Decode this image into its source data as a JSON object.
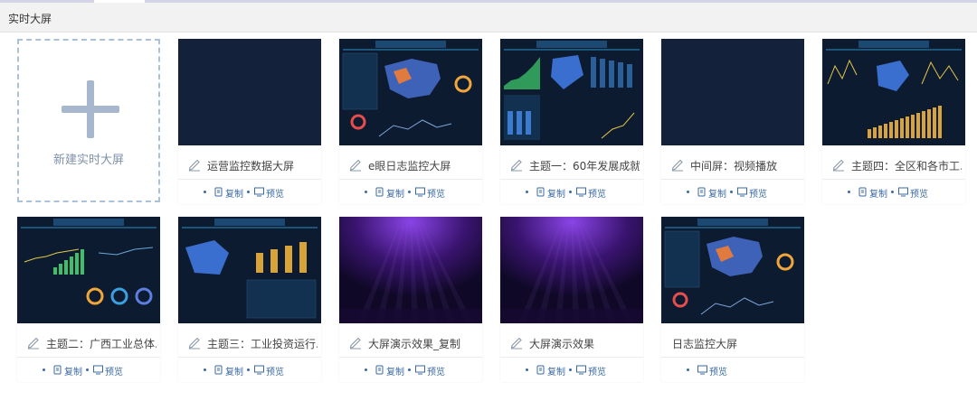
{
  "header": {
    "title": "实时大屏"
  },
  "new_card": {
    "label": "新建实时大屏"
  },
  "actions": {
    "copy": "复制",
    "preview": "预览"
  },
  "colors": {
    "accent": "#3b6aa3",
    "thumb_dark": "#14213a",
    "dashed": "#a9c1da"
  },
  "cards": [
    {
      "name": "运营监控数据大屏",
      "thumb": "blank",
      "editable": true,
      "copyable": true
    },
    {
      "name": "e眼日志监控大屏",
      "thumb": "map",
      "editable": true,
      "copyable": true
    },
    {
      "name": "主题一：60年发展成就...",
      "thumb": "theme1",
      "editable": true,
      "copyable": true
    },
    {
      "name": "中间屏：视频播放",
      "thumb": "blank",
      "editable": true,
      "copyable": true
    },
    {
      "name": "主题四：全区和各市工...",
      "thumb": "theme4",
      "editable": true,
      "copyable": true
    },
    {
      "name": "主题二：广西工业总体...",
      "thumb": "theme2",
      "editable": true,
      "copyable": true
    },
    {
      "name": "主题三：工业投资运行...",
      "thumb": "theme3",
      "editable": true,
      "copyable": true
    },
    {
      "name": "大屏演示效果_复制",
      "thumb": "purple",
      "editable": true,
      "copyable": true
    },
    {
      "name": "大屏演示效果",
      "thumb": "purple",
      "editable": true,
      "copyable": true
    },
    {
      "name": "日志监控大屏",
      "thumb": "map",
      "editable": false,
      "copyable": false
    }
  ]
}
